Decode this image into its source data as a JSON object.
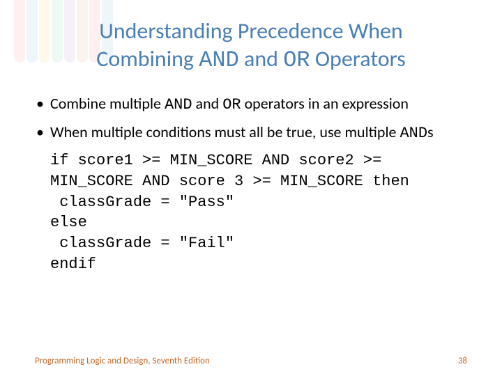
{
  "title": {
    "line1_prefix": "Understanding Precedence When",
    "line2_prefix": "Combining ",
    "and": "AND",
    "mid": " and ",
    "or": "OR",
    "line2_suffix": " Operators"
  },
  "bullets": [
    {
      "seg1": "Combine multiple ",
      "mono1": "AND",
      "seg2": " and ",
      "mono2": "OR",
      "seg3": " operators in an expression"
    },
    {
      "seg1": "When multiple conditions must all be true, use multiple ",
      "mono1": "AND",
      "seg2": "s",
      "mono2": "",
      "seg3": ""
    }
  ],
  "code": {
    "l1": "if score1 >= MIN_SCORE AND score2 >= MIN_SCORE AND score 3 >= MIN_SCORE then",
    "l2": " classGrade = \"Pass\"",
    "l3": "else",
    "l4": " classGrade = \"Fail\"",
    "l5": "endif"
  },
  "footer": {
    "text": "Programming Logic and Design, Seventh Edition",
    "page": "38"
  }
}
